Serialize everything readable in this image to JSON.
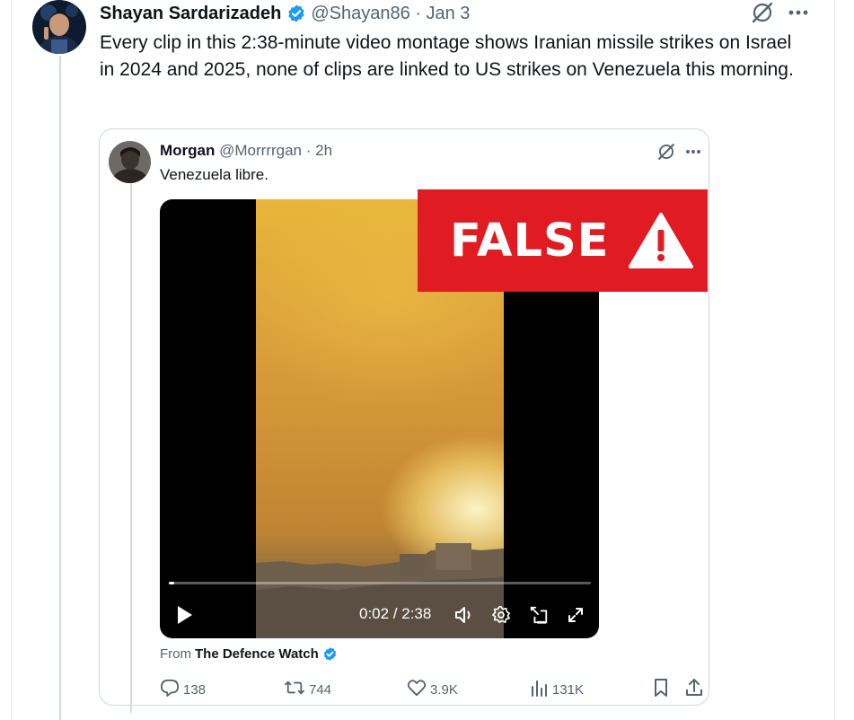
{
  "tweet": {
    "author_name": "Shayan Sardarizadeh",
    "handle": "@Shayan86",
    "date": "Jan 3",
    "text": "Every clip in this 2:38-minute video montage shows Iranian missile strikes on Israel in 2024 and 2025, none of clips are linked to US strikes on Venezuela this morning."
  },
  "quote": {
    "author_name": "Morgan",
    "handle": "@Morrrrgan",
    "time": "2h",
    "text": "Venezuela libre.",
    "video": {
      "time_display": "0:02 / 2:38",
      "progress_fraction": 0.013
    },
    "overlay_label": "FALSE",
    "source_prefix": "From",
    "source_name": "The Defence Watch"
  },
  "stats": {
    "replies": "138",
    "reposts": "744",
    "likes": "3.9K",
    "views": "131K"
  },
  "colors": {
    "verified_blue": "#1d9bf0",
    "false_red": "#e11b22",
    "secondary_text": "#536471"
  },
  "icons": [
    "grok-icon",
    "more-icon",
    "verified-badge-icon",
    "play-icon",
    "volume-icon",
    "settings-icon",
    "dock-icon",
    "fullscreen-icon",
    "reply-icon",
    "repost-icon",
    "like-icon",
    "views-icon",
    "bookmark-icon",
    "share-icon",
    "warning-icon"
  ]
}
